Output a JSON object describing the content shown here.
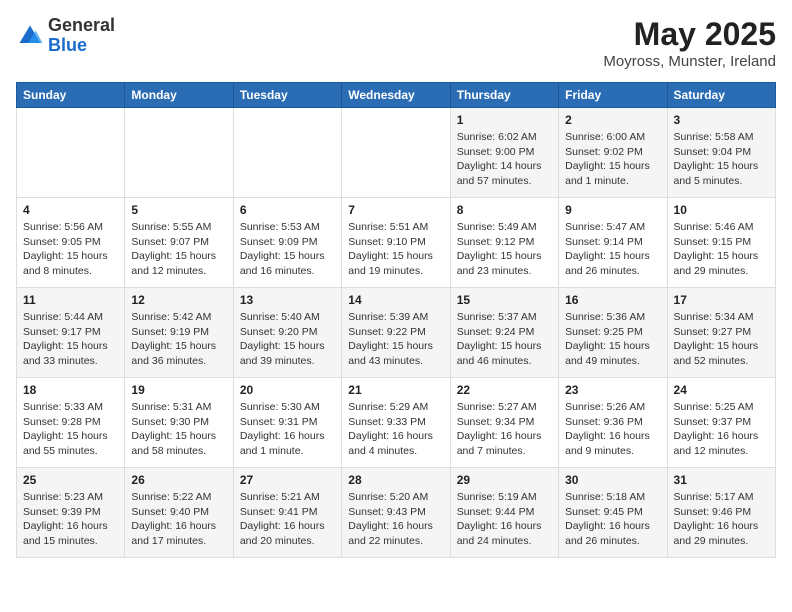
{
  "header": {
    "logo_general": "General",
    "logo_blue": "Blue",
    "month": "May 2025",
    "location": "Moyross, Munster, Ireland"
  },
  "columns": [
    "Sunday",
    "Monday",
    "Tuesday",
    "Wednesday",
    "Thursday",
    "Friday",
    "Saturday"
  ],
  "weeks": [
    [
      {
        "day": "",
        "sunrise": "",
        "sunset": "",
        "daylight": ""
      },
      {
        "day": "",
        "sunrise": "",
        "sunset": "",
        "daylight": ""
      },
      {
        "day": "",
        "sunrise": "",
        "sunset": "",
        "daylight": ""
      },
      {
        "day": "",
        "sunrise": "",
        "sunset": "",
        "daylight": ""
      },
      {
        "day": "1",
        "sunrise": "Sunrise: 6:02 AM",
        "sunset": "Sunset: 9:00 PM",
        "daylight": "Daylight: 14 hours and 57 minutes."
      },
      {
        "day": "2",
        "sunrise": "Sunrise: 6:00 AM",
        "sunset": "Sunset: 9:02 PM",
        "daylight": "Daylight: 15 hours and 1 minute."
      },
      {
        "day": "3",
        "sunrise": "Sunrise: 5:58 AM",
        "sunset": "Sunset: 9:04 PM",
        "daylight": "Daylight: 15 hours and 5 minutes."
      }
    ],
    [
      {
        "day": "4",
        "sunrise": "Sunrise: 5:56 AM",
        "sunset": "Sunset: 9:05 PM",
        "daylight": "Daylight: 15 hours and 8 minutes."
      },
      {
        "day": "5",
        "sunrise": "Sunrise: 5:55 AM",
        "sunset": "Sunset: 9:07 PM",
        "daylight": "Daylight: 15 hours and 12 minutes."
      },
      {
        "day": "6",
        "sunrise": "Sunrise: 5:53 AM",
        "sunset": "Sunset: 9:09 PM",
        "daylight": "Daylight: 15 hours and 16 minutes."
      },
      {
        "day": "7",
        "sunrise": "Sunrise: 5:51 AM",
        "sunset": "Sunset: 9:10 PM",
        "daylight": "Daylight: 15 hours and 19 minutes."
      },
      {
        "day": "8",
        "sunrise": "Sunrise: 5:49 AM",
        "sunset": "Sunset: 9:12 PM",
        "daylight": "Daylight: 15 hours and 23 minutes."
      },
      {
        "day": "9",
        "sunrise": "Sunrise: 5:47 AM",
        "sunset": "Sunset: 9:14 PM",
        "daylight": "Daylight: 15 hours and 26 minutes."
      },
      {
        "day": "10",
        "sunrise": "Sunrise: 5:46 AM",
        "sunset": "Sunset: 9:15 PM",
        "daylight": "Daylight: 15 hours and 29 minutes."
      }
    ],
    [
      {
        "day": "11",
        "sunrise": "Sunrise: 5:44 AM",
        "sunset": "Sunset: 9:17 PM",
        "daylight": "Daylight: 15 hours and 33 minutes."
      },
      {
        "day": "12",
        "sunrise": "Sunrise: 5:42 AM",
        "sunset": "Sunset: 9:19 PM",
        "daylight": "Daylight: 15 hours and 36 minutes."
      },
      {
        "day": "13",
        "sunrise": "Sunrise: 5:40 AM",
        "sunset": "Sunset: 9:20 PM",
        "daylight": "Daylight: 15 hours and 39 minutes."
      },
      {
        "day": "14",
        "sunrise": "Sunrise: 5:39 AM",
        "sunset": "Sunset: 9:22 PM",
        "daylight": "Daylight: 15 hours and 43 minutes."
      },
      {
        "day": "15",
        "sunrise": "Sunrise: 5:37 AM",
        "sunset": "Sunset: 9:24 PM",
        "daylight": "Daylight: 15 hours and 46 minutes."
      },
      {
        "day": "16",
        "sunrise": "Sunrise: 5:36 AM",
        "sunset": "Sunset: 9:25 PM",
        "daylight": "Daylight: 15 hours and 49 minutes."
      },
      {
        "day": "17",
        "sunrise": "Sunrise: 5:34 AM",
        "sunset": "Sunset: 9:27 PM",
        "daylight": "Daylight: 15 hours and 52 minutes."
      }
    ],
    [
      {
        "day": "18",
        "sunrise": "Sunrise: 5:33 AM",
        "sunset": "Sunset: 9:28 PM",
        "daylight": "Daylight: 15 hours and 55 minutes."
      },
      {
        "day": "19",
        "sunrise": "Sunrise: 5:31 AM",
        "sunset": "Sunset: 9:30 PM",
        "daylight": "Daylight: 15 hours and 58 minutes."
      },
      {
        "day": "20",
        "sunrise": "Sunrise: 5:30 AM",
        "sunset": "Sunset: 9:31 PM",
        "daylight": "Daylight: 16 hours and 1 minute."
      },
      {
        "day": "21",
        "sunrise": "Sunrise: 5:29 AM",
        "sunset": "Sunset: 9:33 PM",
        "daylight": "Daylight: 16 hours and 4 minutes."
      },
      {
        "day": "22",
        "sunrise": "Sunrise: 5:27 AM",
        "sunset": "Sunset: 9:34 PM",
        "daylight": "Daylight: 16 hours and 7 minutes."
      },
      {
        "day": "23",
        "sunrise": "Sunrise: 5:26 AM",
        "sunset": "Sunset: 9:36 PM",
        "daylight": "Daylight: 16 hours and 9 minutes."
      },
      {
        "day": "24",
        "sunrise": "Sunrise: 5:25 AM",
        "sunset": "Sunset: 9:37 PM",
        "daylight": "Daylight: 16 hours and 12 minutes."
      }
    ],
    [
      {
        "day": "25",
        "sunrise": "Sunrise: 5:23 AM",
        "sunset": "Sunset: 9:39 PM",
        "daylight": "Daylight: 16 hours and 15 minutes."
      },
      {
        "day": "26",
        "sunrise": "Sunrise: 5:22 AM",
        "sunset": "Sunset: 9:40 PM",
        "daylight": "Daylight: 16 hours and 17 minutes."
      },
      {
        "day": "27",
        "sunrise": "Sunrise: 5:21 AM",
        "sunset": "Sunset: 9:41 PM",
        "daylight": "Daylight: 16 hours and 20 minutes."
      },
      {
        "day": "28",
        "sunrise": "Sunrise: 5:20 AM",
        "sunset": "Sunset: 9:43 PM",
        "daylight": "Daylight: 16 hours and 22 minutes."
      },
      {
        "day": "29",
        "sunrise": "Sunrise: 5:19 AM",
        "sunset": "Sunset: 9:44 PM",
        "daylight": "Daylight: 16 hours and 24 minutes."
      },
      {
        "day": "30",
        "sunrise": "Sunrise: 5:18 AM",
        "sunset": "Sunset: 9:45 PM",
        "daylight": "Daylight: 16 hours and 26 minutes."
      },
      {
        "day": "31",
        "sunrise": "Sunrise: 5:17 AM",
        "sunset": "Sunset: 9:46 PM",
        "daylight": "Daylight: 16 hours and 29 minutes."
      }
    ]
  ]
}
